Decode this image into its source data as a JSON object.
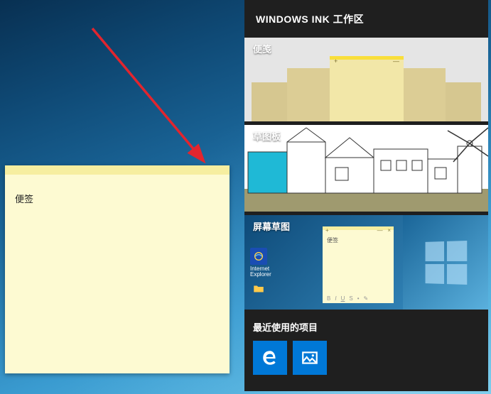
{
  "desktop": {
    "sticky_note": {
      "content": "便签"
    }
  },
  "ink_workspace": {
    "title": "WINDOWS INK 工作区",
    "sections": {
      "sticky_notes": {
        "label": "便笺"
      },
      "sketchpad": {
        "label": "草图板"
      },
      "screen_sketch": {
        "label": "屏幕草图",
        "note_text": "便签",
        "ie_label": "Internet Explorer"
      },
      "recent": {
        "label": "最近使用的项目",
        "items": [
          {
            "name": "edge-browser"
          },
          {
            "name": "photos-app"
          }
        ]
      }
    }
  }
}
